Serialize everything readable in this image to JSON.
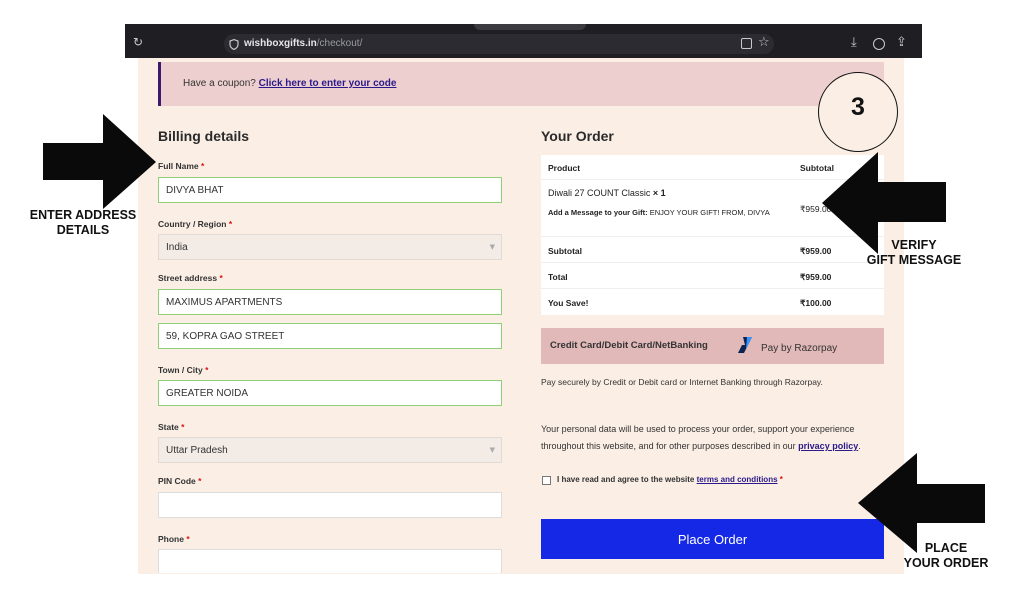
{
  "browser": {
    "url_domain": "wishboxgifts.in",
    "url_path": "/checkout/",
    "icons": [
      "reload-icon",
      "shield-icon",
      "reader-view-icon",
      "star-icon",
      "download-icon",
      "account-icon",
      "share-icon"
    ]
  },
  "coupon": {
    "prompt": "Have a coupon?",
    "link": "Click here to enter your code"
  },
  "billing": {
    "title": "Billing details",
    "full_name_label": "Full Name",
    "full_name_value": "DIVYA BHAT",
    "country_label": "Country / Region",
    "country_value": "India",
    "street_label": "Street address",
    "street_line1": "MAXIMUS APARTMENTS",
    "street_line2": "59, KOPRA GAO STREET",
    "town_label": "Town / City",
    "town_value": "GREATER NOIDA",
    "state_label": "State",
    "state_value": "Uttar Pradesh",
    "pin_label": "PIN Code",
    "pin_value": "",
    "phone_label": "Phone",
    "phone_value": "",
    "required_mark": "*"
  },
  "order": {
    "title": "Your Order",
    "col_product": "Product",
    "col_subtotal": "Subtotal",
    "item_name": "Diwali 27 COUNT Classic",
    "item_qty": "× 1",
    "gift_label": "Add a Message to your Gift:",
    "gift_message": "ENJOY YOUR GIFT! FROM, DIVYA",
    "item_price": "₹959.00",
    "subtotal_label": "Subtotal",
    "subtotal_value": "₹959.00",
    "total_label": "Total",
    "total_value": "₹959.00",
    "save_label": "You Save!",
    "save_value": "₹100.00"
  },
  "payment": {
    "method_label": "Credit Card/Debit Card/NetBanking",
    "provider": "Pay by Razorpay",
    "description": "Pay securely by Credit or Debit card or Internet Banking through Razorpay.",
    "privacy_text": "Your personal data will be used to process your order, support your experience throughout this website, and for other purposes described in our",
    "privacy_link": "privacy policy",
    "privacy_end": ".",
    "terms_text": "I have read and agree to the website",
    "terms_link": "terms and conditions",
    "place_order": "Place Order"
  },
  "annotations": {
    "step": "3",
    "enter_address_1": "ENTER ADDRESS",
    "enter_address_2": "DETAILS",
    "verify_1": "VERIFY",
    "verify_2": "GIFT MESSAGE",
    "place_1": "PLACE",
    "place_2": "YOUR ORDER"
  },
  "colors": {
    "page_bg": "#faeee5",
    "coupon_bg": "#eecfcf",
    "payment_bg": "#e2b9b9",
    "accent_button": "#1428e6",
    "link": "#2a1a8a",
    "valid_border": "#8fcf76"
  }
}
